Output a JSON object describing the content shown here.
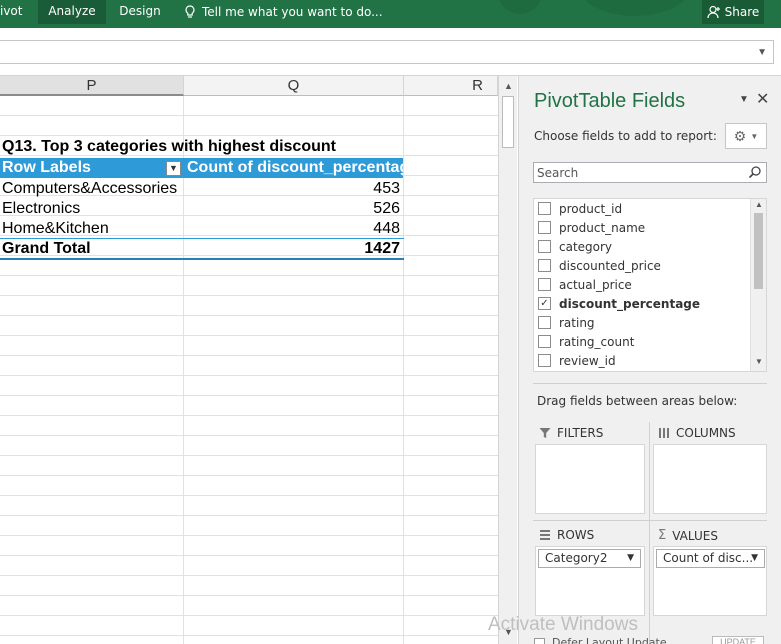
{
  "ribbon": {
    "tabs": [
      {
        "label": "ivot"
      },
      {
        "label": "Analyze"
      },
      {
        "label": "Design"
      }
    ],
    "tell_me": "Tell me what you want to do...",
    "share": "Share",
    "bg_color": "#217346"
  },
  "grid": {
    "columns": [
      "P",
      "Q",
      "R"
    ],
    "title": "Q13. Top 3 categories with highest discount",
    "pivot_header": {
      "row_labels": "Row Labels",
      "value_header": "Count of discount_percentage"
    },
    "rows": [
      {
        "label": "Computers&Accessories",
        "value": "453"
      },
      {
        "label": "Electronics",
        "value": "526"
      },
      {
        "label": "Home&Kitchen",
        "value": "448"
      }
    ],
    "grand_total": {
      "label": "Grand Total",
      "value": "1427"
    },
    "header_color": "#2f9ad8"
  },
  "pane": {
    "title": "PivotTable Fields",
    "choose_label": "Choose fields to add to report:",
    "search_placeholder": "Search",
    "fields": [
      {
        "name": "product_id",
        "checked": false
      },
      {
        "name": "product_name",
        "checked": false
      },
      {
        "name": "category",
        "checked": false
      },
      {
        "name": "discounted_price",
        "checked": false
      },
      {
        "name": "actual_price",
        "checked": false
      },
      {
        "name": "discount_percentage",
        "checked": true
      },
      {
        "name": "rating",
        "checked": false
      },
      {
        "name": "rating_count",
        "checked": false
      },
      {
        "name": "review_id",
        "checked": false
      }
    ],
    "drag_label": "Drag fields between areas below:",
    "areas": {
      "filters": "FILTERS",
      "columns": "COLUMNS",
      "rows": "ROWS",
      "values": "VALUES"
    },
    "rows_field": "Category2",
    "values_field": "Count of disc...",
    "defer_label": "Defer Layout Update",
    "update_label": "UPDATE",
    "title_color": "#217346"
  },
  "watermark": "Activate Windows"
}
